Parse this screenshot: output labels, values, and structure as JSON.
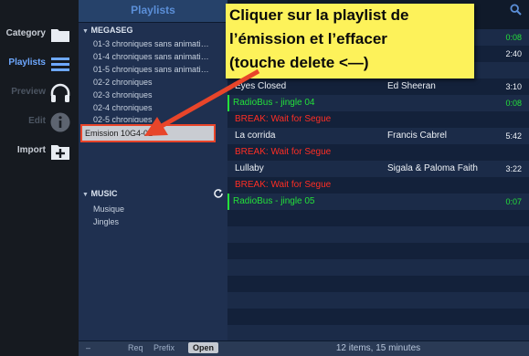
{
  "sidebar": {
    "items": [
      {
        "label": "Category"
      },
      {
        "label": "Playlists"
      },
      {
        "label": "Preview"
      },
      {
        "label": "Edit"
      },
      {
        "label": "Import"
      }
    ]
  },
  "playlists": {
    "title": "Playlists",
    "groups": [
      {
        "name": "MEGASEG",
        "items": [
          "01-3 chroniques sans animati…",
          "01-4 chroniques sans animati…",
          "01-5 chroniques sans animati…",
          "02-2 chroniques",
          "02-3 chroniques",
          "02-4 chroniques",
          "02-5 chroniques",
          "Emission 10G4-01"
        ]
      },
      {
        "name": "MUSIC",
        "items": [
          "Musique",
          "Jingles"
        ]
      }
    ],
    "bottom": {
      "minus": "–",
      "req": "Req",
      "prefix": "Prefix",
      "open": "Open"
    }
  },
  "tracks": {
    "rows": [
      {
        "title": "",
        "artist": "",
        "duration": "0:08",
        "type": "jingle"
      },
      {
        "title": "",
        "artist": "hn",
        "duration": "2:40",
        "type": "normal"
      },
      {
        "title": "BREAK: Wait for Segue",
        "artist": "",
        "duration": "",
        "type": "break"
      },
      {
        "title": "Eyes Closed",
        "artist": "Ed Sheeran",
        "duration": "3:10",
        "type": "normal"
      },
      {
        "title": "RadioBus - jingle 04",
        "artist": "",
        "duration": "0:08",
        "type": "jingle"
      },
      {
        "title": "BREAK: Wait for Segue",
        "artist": "",
        "duration": "",
        "type": "break"
      },
      {
        "title": "La corrida",
        "artist": "Francis Cabrel",
        "duration": "5:42",
        "type": "normal"
      },
      {
        "title": "BREAK: Wait for Segue",
        "artist": "",
        "duration": "",
        "type": "break"
      },
      {
        "title": "Lullaby",
        "artist": "Sigala & Paloma Faith",
        "duration": "3:22",
        "type": "normal"
      },
      {
        "title": "BREAK: Wait for Segue",
        "artist": "",
        "duration": "",
        "type": "break"
      },
      {
        "title": "RadioBus - jingle 05",
        "artist": "",
        "duration": "0:07",
        "type": "jingle"
      }
    ],
    "status": "12 items, 15 minutes"
  },
  "annotation": {
    "lines": [
      "Cliquer sur la playlist de",
      "l’émission et l’effacer",
      "(touche delete <—)"
    ]
  },
  "colors": {
    "break": "#ff2e24",
    "jingle": "#24e03a",
    "accent": "#5b8fd8",
    "annotation_bg": "#fdf25a",
    "arrow": "#e8452a"
  }
}
